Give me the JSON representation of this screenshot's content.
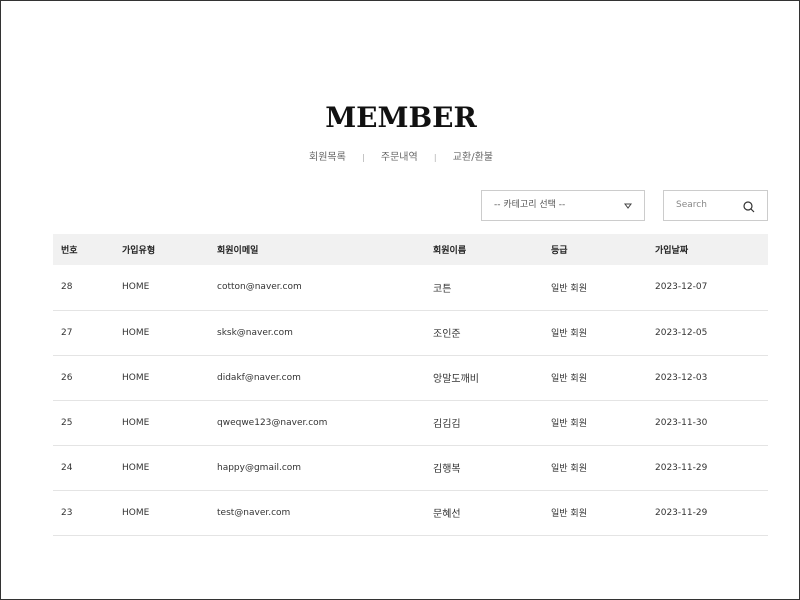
{
  "page_title": "MEMBER",
  "subnav": [
    "회원목록",
    "주문내역",
    "교환/환불"
  ],
  "filter": {
    "category_select": "-- 카테고리 선택 --",
    "search_placeholder": "Search"
  },
  "table": {
    "headers": [
      "번호",
      "가입유형",
      "회원이메일",
      "회원이름",
      "등급",
      "가입날짜"
    ],
    "rows": [
      [
        "28",
        "HOME",
        "cotton@naver.com",
        "코튼",
        "일반 회원",
        "2023-12-07"
      ],
      [
        "27",
        "HOME",
        "sksk@naver.com",
        "조인준",
        "일반 회원",
        "2023-12-05"
      ],
      [
        "26",
        "HOME",
        "didakf@naver.com",
        "앙말도깨비",
        "일반 회원",
        "2023-12-03"
      ],
      [
        "25",
        "HOME",
        "qweqwe123@naver.com",
        "김김김",
        "일반 회원",
        "2023-11-30"
      ],
      [
        "24",
        "HOME",
        "happy@gmail.com",
        "김행복",
        "일반 회원",
        "2023-11-29"
      ],
      [
        "23",
        "HOME",
        "test@naver.com",
        "문혜선",
        "일반 회원",
        "2023-11-29"
      ]
    ]
  }
}
